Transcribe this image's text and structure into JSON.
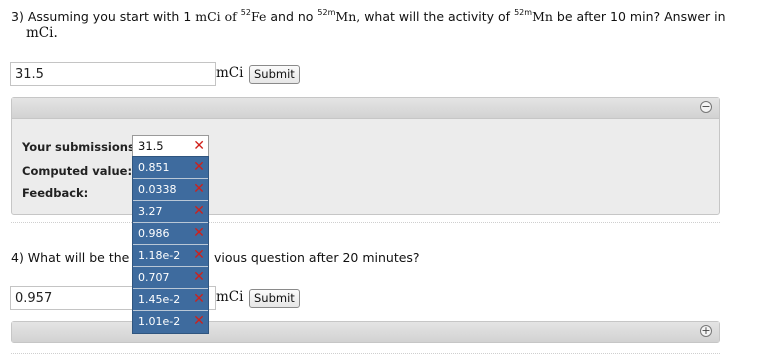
{
  "q3": {
    "number": "3)",
    "p1": "Assuming you start with 1",
    "p2": "mCi of",
    "iso_fe_sup": "52",
    "iso_fe": "Fe",
    "p3": "and no",
    "iso_mn_sup": "52m",
    "iso_mn": "Mn,",
    "p4": "what will the activity of",
    "iso_mn2_sup": "52m",
    "iso_mn2": "Mn",
    "p5": "be after 10 min? Answer in",
    "unit_line2": "mCi.",
    "answer_value": "31.5",
    "unit": "mCi",
    "submit_label": "Submit"
  },
  "panel1": {
    "toggle": "−",
    "your_submissions_label": "Your submissions:",
    "current_submission": "31.5",
    "computed_label": "Computed value: 31",
    "feedback_label": "Feedback:"
  },
  "submissions_dropdown": [
    {
      "value": "0.851"
    },
    {
      "value": "0.0338"
    },
    {
      "value": "3.27"
    },
    {
      "value": "0.986"
    },
    {
      "value": "1.18e-2"
    },
    {
      "value": "0.707"
    },
    {
      "value": "1.45e-2"
    },
    {
      "value": "1.01e-2"
    }
  ],
  "q4": {
    "prefix": "4) What will be the a",
    "suffix": "vious question after 20 minutes?",
    "answer_value": "0.957",
    "unit": "mCi",
    "submit_label": "Submit"
  },
  "panel2": {
    "toggle": "+"
  },
  "icons": {
    "remove": "✕"
  }
}
